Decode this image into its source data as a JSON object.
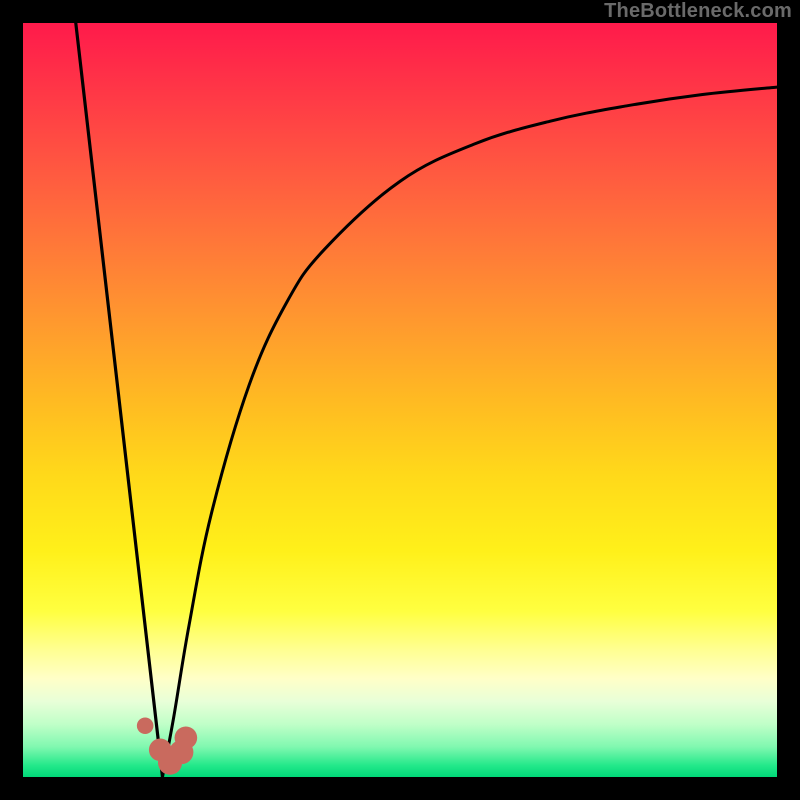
{
  "watermark": "TheBottleneck.com",
  "chart_data": {
    "type": "line",
    "title": "",
    "xlabel": "",
    "ylabel": "",
    "xlim": [
      0,
      100
    ],
    "ylim": [
      0,
      100
    ],
    "grid": false,
    "series": [
      {
        "name": "left-line",
        "x": [
          7,
          18.5
        ],
        "y": [
          100,
          0
        ]
      },
      {
        "name": "right-curve",
        "x": [
          18.5,
          20,
          22,
          25,
          30,
          35,
          40,
          50,
          60,
          70,
          80,
          90,
          100
        ],
        "y": [
          0,
          8,
          20,
          35,
          52,
          63,
          70,
          79,
          84,
          87,
          89,
          90.5,
          91.5
        ]
      }
    ],
    "markers": [
      {
        "name": "dot",
        "x": 16.2,
        "y": 6.8,
        "color": "#c96a5e",
        "r": 1.1
      },
      {
        "name": "blob1",
        "x": 18.2,
        "y": 3.6,
        "color": "#c96a5e",
        "r": 1.5
      },
      {
        "name": "blob2",
        "x": 19.5,
        "y": 1.9,
        "color": "#c96a5e",
        "r": 1.6
      },
      {
        "name": "blob3",
        "x": 21.0,
        "y": 3.3,
        "color": "#c96a5e",
        "r": 1.6
      },
      {
        "name": "blob4",
        "x": 21.6,
        "y": 5.2,
        "color": "#c96a5e",
        "r": 1.5
      }
    ]
  }
}
